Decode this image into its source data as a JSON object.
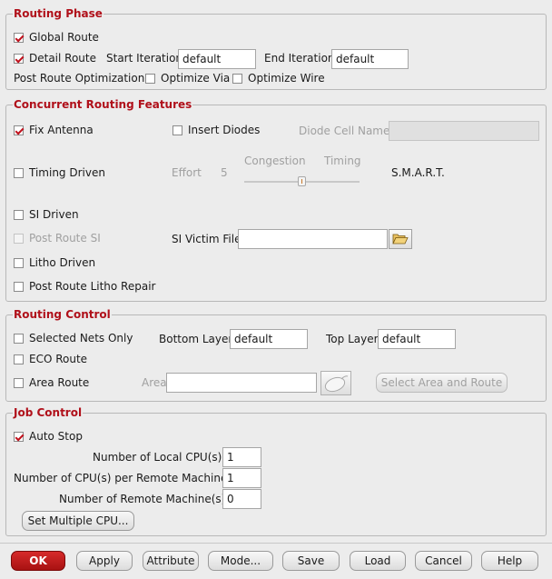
{
  "routing_phase": {
    "title": "Routing Phase",
    "global_route": {
      "label": "Global Route",
      "checked": true
    },
    "detail_route": {
      "label": "Detail Route",
      "checked": true
    },
    "start_iteration": {
      "label": "Start Iteration",
      "value": "default"
    },
    "end_iteration": {
      "label": "End Iteration",
      "value": "default"
    },
    "post_route_opt": {
      "label": "Post Route Optimization"
    },
    "optimize_via": {
      "label": "Optimize Via",
      "checked": false
    },
    "optimize_wire": {
      "label": "Optimize Wire",
      "checked": false
    }
  },
  "concurrent": {
    "title": "Concurrent Routing Features",
    "fix_antenna": {
      "label": "Fix Antenna",
      "checked": true
    },
    "insert_diodes": {
      "label": "Insert Diodes",
      "checked": false
    },
    "diode_cell_name": {
      "label": "Diode Cell Name",
      "value": ""
    },
    "timing_driven": {
      "label": "Timing Driven",
      "checked": false
    },
    "effort": {
      "label": "Effort",
      "value": "5"
    },
    "slider": {
      "left_label": "Congestion",
      "right_label": "Timing",
      "value": 0.5
    },
    "smart": {
      "label": "S.M.A.R.T."
    },
    "si_driven": {
      "label": "SI Driven",
      "checked": false
    },
    "post_route_si": {
      "label": "Post Route SI",
      "checked": false
    },
    "si_victim_file": {
      "label": "SI Victim File",
      "value": ""
    },
    "litho_driven": {
      "label": "Litho Driven",
      "checked": false
    },
    "post_route_litho": {
      "label": "Post Route Litho Repair",
      "checked": false
    }
  },
  "routing_control": {
    "title": "Routing Control",
    "selected_nets": {
      "label": "Selected Nets Only",
      "checked": false
    },
    "bottom_layer": {
      "label": "Bottom Layer",
      "value": "default"
    },
    "top_layer": {
      "label": "Top Layer",
      "value": "default"
    },
    "eco_route": {
      "label": "ECO Route",
      "checked": false
    },
    "area_route": {
      "label": "Area Route",
      "checked": false
    },
    "area": {
      "label": "Area",
      "value": ""
    },
    "select_area_button": "Select Area and Route"
  },
  "job_control": {
    "title": "Job Control",
    "auto_stop": {
      "label": "Auto Stop",
      "checked": true
    },
    "local_cpus": {
      "label": "Number of Local CPU(s):",
      "value": "1"
    },
    "cpus_per_remote": {
      "label": "Number of CPU(s) per Remote Machine:",
      "value": "1"
    },
    "remote_machines": {
      "label": "Number of Remote Machine(s):",
      "value": "0"
    },
    "set_multiple_cpu": "Set Multiple CPU..."
  },
  "buttons": {
    "ok": "OK",
    "apply": "Apply",
    "attribute": "Attribute",
    "mode": "Mode...",
    "save": "Save",
    "load": "Load",
    "cancel": "Cancel",
    "help": "Help"
  },
  "icons": {
    "folder": "folder-open-icon",
    "mouse": "mouse-select-icon"
  },
  "colors": {
    "section_title": "#b0101a",
    "checkmark": "#c0101c",
    "ok_button": "#c01818"
  }
}
